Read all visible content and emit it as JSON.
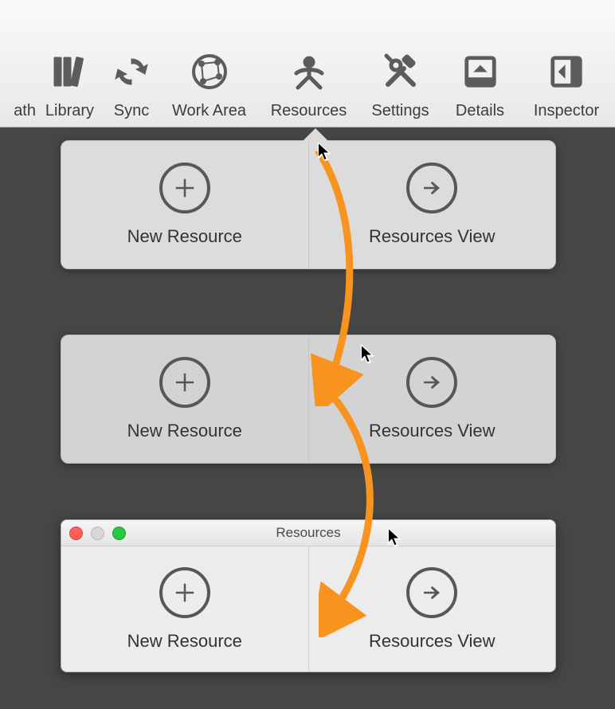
{
  "toolbar": {
    "path": {
      "label": "ath"
    },
    "library": {
      "label": "Library"
    },
    "sync": {
      "label": "Sync"
    },
    "workarea": {
      "label": "Work Area"
    },
    "resources": {
      "label": "Resources"
    },
    "settings": {
      "label": "Settings"
    },
    "details": {
      "label": "Details"
    },
    "inspector": {
      "label": "Inspector"
    }
  },
  "popover": {
    "new_label": "New Resource",
    "view_label": "Resources View"
  },
  "window": {
    "title": "Resources",
    "new_label": "New Resource",
    "view_label": "Resources View"
  },
  "colors": {
    "arrow": "#f7931e"
  }
}
